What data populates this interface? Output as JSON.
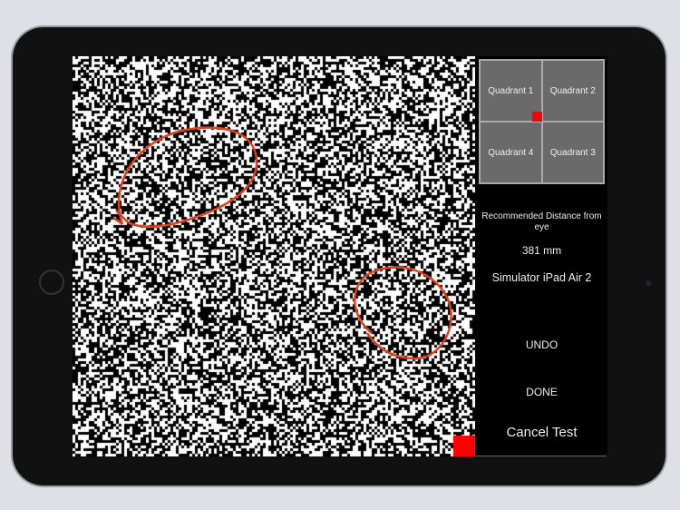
{
  "quadrants": [
    "Quadrant 1",
    "Quadrant 2",
    "Quadrant 4",
    "Quadrant 3"
  ],
  "panel": {
    "distance_label": "Recommended Distance from eye",
    "distance_value": "381 mm",
    "device": "Simulator iPad Air 2",
    "undo": "UNDO",
    "done": "DONE",
    "cancel": "Cancel Test"
  },
  "colors": {
    "marker": "#ff0000",
    "annotation": "#e0401a"
  }
}
